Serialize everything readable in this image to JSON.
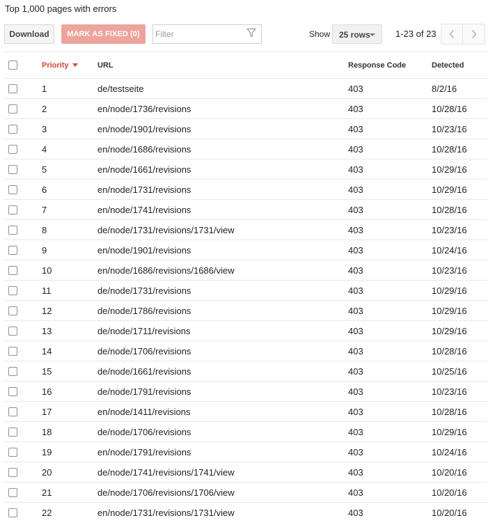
{
  "title": "Top 1,000 pages with errors",
  "toolbar": {
    "download_label": "Download",
    "mark_fixed_label": "MARK AS FIXED (0)",
    "filter_placeholder": "Filter",
    "filter_value": "",
    "show_label": "Show",
    "rows_value": "25 rows",
    "range_text": "1-23 of 23"
  },
  "colors": {
    "accent": "#d14836",
    "mark_fixed_bg": "#eda49d"
  },
  "icons": {
    "filter": "filter-funnel-icon",
    "prev": "chevron-left-icon",
    "next": "chevron-right-icon",
    "sort": "sort-desc-caret-icon"
  },
  "table": {
    "headers": {
      "priority": "Priority",
      "url": "URL",
      "response_code": "Response Code",
      "detected": "Detected"
    },
    "rows": [
      {
        "priority": "1",
        "url": "de/testseite",
        "code": "403",
        "detected": "8/2/16"
      },
      {
        "priority": "2",
        "url": "en/node/1736/revisions",
        "code": "403",
        "detected": "10/28/16"
      },
      {
        "priority": "3",
        "url": "en/node/1901/revisions",
        "code": "403",
        "detected": "10/23/16"
      },
      {
        "priority": "4",
        "url": "en/node/1686/revisions",
        "code": "403",
        "detected": "10/28/16"
      },
      {
        "priority": "5",
        "url": "en/node/1661/revisions",
        "code": "403",
        "detected": "10/29/16"
      },
      {
        "priority": "6",
        "url": "en/node/1731/revisions",
        "code": "403",
        "detected": "10/29/16"
      },
      {
        "priority": "7",
        "url": "en/node/1741/revisions",
        "code": "403",
        "detected": "10/28/16"
      },
      {
        "priority": "8",
        "url": "de/node/1731/revisions/1731/view",
        "code": "403",
        "detected": "10/23/16"
      },
      {
        "priority": "9",
        "url": "en/node/1901/revisions",
        "code": "403",
        "detected": "10/24/16"
      },
      {
        "priority": "10",
        "url": "en/node/1686/revisions/1686/view",
        "code": "403",
        "detected": "10/23/16"
      },
      {
        "priority": "11",
        "url": "de/node/1731/revisions",
        "code": "403",
        "detected": "10/29/16"
      },
      {
        "priority": "12",
        "url": "de/node/1786/revisions",
        "code": "403",
        "detected": "10/29/16"
      },
      {
        "priority": "13",
        "url": "de/node/1711/revisions",
        "code": "403",
        "detected": "10/29/16"
      },
      {
        "priority": "14",
        "url": "de/node/1706/revisions",
        "code": "403",
        "detected": "10/28/16"
      },
      {
        "priority": "15",
        "url": "de/node/1661/revisions",
        "code": "403",
        "detected": "10/25/16"
      },
      {
        "priority": "16",
        "url": "de/node/1791/revisions",
        "code": "403",
        "detected": "10/23/16"
      },
      {
        "priority": "17",
        "url": "en/node/1411/revisions",
        "code": "403",
        "detected": "10/28/16"
      },
      {
        "priority": "18",
        "url": "de/node/1706/revisions",
        "code": "403",
        "detected": "10/29/16"
      },
      {
        "priority": "19",
        "url": "en/node/1791/revisions",
        "code": "403",
        "detected": "10/24/16"
      },
      {
        "priority": "20",
        "url": "de/node/1741/revisions/1741/view",
        "code": "403",
        "detected": "10/20/16"
      },
      {
        "priority": "21",
        "url": "de/node/1706/revisions/1706/view",
        "code": "403",
        "detected": "10/20/16"
      },
      {
        "priority": "22",
        "url": "en/node/1731/revisions/1731/view",
        "code": "403",
        "detected": "10/20/16"
      }
    ]
  }
}
